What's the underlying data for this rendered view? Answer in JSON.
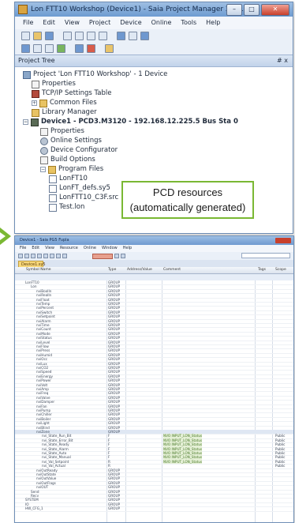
{
  "top_window": {
    "title": "Lon FTT10 Workshop (Device1) - Saia Project Manager 2.1.1...",
    "controls": {
      "minimize": "–",
      "maximize": "□",
      "close": "✕"
    },
    "menu": [
      "File",
      "Edit",
      "View",
      "Project",
      "Device",
      "Online",
      "Tools",
      "Help"
    ],
    "pane_title": "Project Tree",
    "pane_pin": "# x",
    "tree": [
      {
        "label": "Project 'Lon FTT10 Workshop' - 1 Device",
        "icon": "project-icon",
        "level": 0,
        "bold": false
      },
      {
        "label": "Properties",
        "icon": "properties-icon",
        "level": 1,
        "bold": false
      },
      {
        "label": "TCP/IP Settings Table",
        "icon": "tcpip-table-icon",
        "level": 1,
        "bold": false
      },
      {
        "label": "Common Files",
        "icon": "folder-icon",
        "level": 1,
        "bold": false
      },
      {
        "label": "Library Manager",
        "icon": "library-icon",
        "level": 1,
        "bold": false
      },
      {
        "label": "Device1 - PCD3.M3120 - 192.168.12.225.5 Bus Sta 0",
        "icon": "device-icon",
        "level": 0,
        "bold": true
      },
      {
        "label": "Properties",
        "icon": "properties-icon",
        "level": 2,
        "bold": false
      },
      {
        "label": "Online Settings",
        "icon": "online-settings-icon",
        "level": 2,
        "bold": false
      },
      {
        "label": "Device Configurator",
        "icon": "gear-icon",
        "level": 2,
        "bold": false
      },
      {
        "label": "Build Options",
        "icon": "build-options-icon",
        "level": 2,
        "bold": false
      },
      {
        "label": "Program Files",
        "icon": "folder-icon",
        "level": 2,
        "bold": false
      },
      {
        "label": "LonFT10",
        "icon": "file-icon",
        "level": 3,
        "bold": false
      },
      {
        "label": "LonFT_defs.sy5",
        "icon": "file-icon",
        "level": 3,
        "bold": false
      },
      {
        "label": "LonFTT10_C3F.src",
        "icon": "file-icon",
        "level": 3,
        "bold": false
      },
      {
        "label": "Test.lon",
        "icon": "file-icon",
        "level": 3,
        "bold": false
      }
    ],
    "callout": {
      "line1": "PCD resources",
      "line2": "(automatically generated)"
    }
  },
  "bottom_window": {
    "title": "Device1 - Saia PG5 Fupla",
    "menu": [
      "File",
      "Edit",
      "View",
      "Resource",
      "Online",
      "Window",
      "Help"
    ],
    "tab": "Device1.sy5",
    "columns": [
      "Symbol Name",
      "Type",
      "Address/Value",
      "Comment",
      "Tags",
      "Scope"
    ],
    "rows": [
      {
        "name": "LonFT10",
        "type": "GROUP",
        "addr": "",
        "comment": "",
        "scope": "",
        "indent": 1,
        "sel": false
      },
      {
        "name": "Lon",
        "type": "GROUP",
        "addr": "",
        "comment": "",
        "scope": "",
        "indent": 2,
        "sel": false
      },
      {
        "name": "nviBoolIn",
        "type": "GROUP",
        "addr": "",
        "comment": "",
        "scope": "",
        "indent": 3,
        "sel": false
      },
      {
        "name": "nviRealIn",
        "type": "GROUP",
        "addr": "",
        "comment": "",
        "scope": "",
        "indent": 3,
        "sel": false
      },
      {
        "name": "nviFloat",
        "type": "GROUP",
        "addr": "",
        "comment": "",
        "scope": "",
        "indent": 3,
        "sel": false
      },
      {
        "name": "nviTemp",
        "type": "GROUP",
        "addr": "",
        "comment": "",
        "scope": "",
        "indent": 3,
        "sel": false
      },
      {
        "name": "nviPercent",
        "type": "GROUP",
        "addr": "",
        "comment": "",
        "scope": "",
        "indent": 3,
        "sel": false
      },
      {
        "name": "nviSwitch",
        "type": "GROUP",
        "addr": "",
        "comment": "",
        "scope": "",
        "indent": 3,
        "sel": false
      },
      {
        "name": "nviSetpoint",
        "type": "GROUP",
        "addr": "",
        "comment": "",
        "scope": "",
        "indent": 3,
        "sel": false
      },
      {
        "name": "nviAlarm",
        "type": "GROUP",
        "addr": "",
        "comment": "",
        "scope": "",
        "indent": 3,
        "sel": false
      },
      {
        "name": "nviTime",
        "type": "GROUP",
        "addr": "",
        "comment": "",
        "scope": "",
        "indent": 3,
        "sel": false
      },
      {
        "name": "nviCount",
        "type": "GROUP",
        "addr": "",
        "comment": "",
        "scope": "",
        "indent": 3,
        "sel": false
      },
      {
        "name": "nviMode",
        "type": "GROUP",
        "addr": "",
        "comment": "",
        "scope": "",
        "indent": 3,
        "sel": false
      },
      {
        "name": "nviStatus",
        "type": "GROUP",
        "addr": "",
        "comment": "",
        "scope": "",
        "indent": 3,
        "sel": false
      },
      {
        "name": "nviLevel",
        "type": "GROUP",
        "addr": "",
        "comment": "",
        "scope": "",
        "indent": 3,
        "sel": false
      },
      {
        "name": "nviFlow",
        "type": "GROUP",
        "addr": "",
        "comment": "",
        "scope": "",
        "indent": 3,
        "sel": false
      },
      {
        "name": "nviPress",
        "type": "GROUP",
        "addr": "",
        "comment": "",
        "scope": "",
        "indent": 3,
        "sel": false
      },
      {
        "name": "nviHumid",
        "type": "GROUP",
        "addr": "",
        "comment": "",
        "scope": "",
        "indent": 3,
        "sel": false
      },
      {
        "name": "nviOcc",
        "type": "GROUP",
        "addr": "",
        "comment": "",
        "scope": "",
        "indent": 3,
        "sel": false
      },
      {
        "name": "nviLux",
        "type": "GROUP",
        "addr": "",
        "comment": "",
        "scope": "",
        "indent": 3,
        "sel": false
      },
      {
        "name": "nviCO2",
        "type": "GROUP",
        "addr": "",
        "comment": "",
        "scope": "",
        "indent": 3,
        "sel": false
      },
      {
        "name": "nviSpeed",
        "type": "GROUP",
        "addr": "",
        "comment": "",
        "scope": "",
        "indent": 3,
        "sel": false
      },
      {
        "name": "nviEnergy",
        "type": "GROUP",
        "addr": "",
        "comment": "",
        "scope": "",
        "indent": 3,
        "sel": false
      },
      {
        "name": "nviPower",
        "type": "GROUP",
        "addr": "",
        "comment": "",
        "scope": "",
        "indent": 3,
        "sel": false
      },
      {
        "name": "nviVolt",
        "type": "GROUP",
        "addr": "",
        "comment": "",
        "scope": "",
        "indent": 3,
        "sel": false
      },
      {
        "name": "nviAmp",
        "type": "GROUP",
        "addr": "",
        "comment": "",
        "scope": "",
        "indent": 3,
        "sel": false
      },
      {
        "name": "nviFreq",
        "type": "GROUP",
        "addr": "",
        "comment": "",
        "scope": "",
        "indent": 3,
        "sel": false
      },
      {
        "name": "nviValve",
        "type": "GROUP",
        "addr": "",
        "comment": "",
        "scope": "",
        "indent": 3,
        "sel": false
      },
      {
        "name": "nviDamper",
        "type": "GROUP",
        "addr": "",
        "comment": "",
        "scope": "",
        "indent": 3,
        "sel": false
      },
      {
        "name": "nviFan",
        "type": "GROUP",
        "addr": "",
        "comment": "",
        "scope": "",
        "indent": 3,
        "sel": false
      },
      {
        "name": "nviPump",
        "type": "GROUP",
        "addr": "",
        "comment": "",
        "scope": "",
        "indent": 3,
        "sel": false
      },
      {
        "name": "nviChiller",
        "type": "GROUP",
        "addr": "",
        "comment": "",
        "scope": "",
        "indent": 3,
        "sel": false
      },
      {
        "name": "nviBoiler",
        "type": "GROUP",
        "addr": "",
        "comment": "",
        "scope": "",
        "indent": 3,
        "sel": false
      },
      {
        "name": "nviLight",
        "type": "GROUP",
        "addr": "",
        "comment": "",
        "scope": "",
        "indent": 3,
        "sel": false
      },
      {
        "name": "nviBlind",
        "type": "GROUP",
        "addr": "",
        "comment": "",
        "scope": "",
        "indent": 3,
        "sel": false
      },
      {
        "name": "nviZone",
        "type": "GROUP",
        "addr": "",
        "comment": "",
        "scope": "",
        "indent": 3,
        "sel": true
      },
      {
        "name": "nvi_State_Run_Bit",
        "type": "F",
        "addr": "",
        "comment": "NVO INPUT_LON_Status",
        "scope": "Public",
        "indent": 4,
        "sel": false
      },
      {
        "name": "nvi_State_Error_Bit",
        "type": "F",
        "addr": "",
        "comment": "NVO INPUT_LON_Status",
        "scope": "Public",
        "indent": 4,
        "sel": false
      },
      {
        "name": "nvi_State_Ready",
        "type": "F",
        "addr": "",
        "comment": "NVO INPUT_LON_Status",
        "scope": "Public",
        "indent": 4,
        "sel": false
      },
      {
        "name": "nvi_State_Alarm",
        "type": "F",
        "addr": "",
        "comment": "NVO INPUT_LON_Status",
        "scope": "Public",
        "indent": 4,
        "sel": false
      },
      {
        "name": "nvi_State_Auto",
        "type": "F",
        "addr": "",
        "comment": "NVO INPUT_LON_Status",
        "scope": "Public",
        "indent": 4,
        "sel": false
      },
      {
        "name": "nvi_State_Manual",
        "type": "F",
        "addr": "",
        "comment": "NVO INPUT_LON_Status",
        "scope": "Public",
        "indent": 4,
        "sel": false
      },
      {
        "name": "nvi_Val_Setpoint",
        "type": "R",
        "addr": "",
        "comment": "NVO INPUT_LON_Status",
        "scope": "Public",
        "indent": 4,
        "sel": false
      },
      {
        "name": "nvi_Val_Actual",
        "type": "R",
        "addr": "",
        "comment": "",
        "scope": "Public",
        "indent": 4,
        "sel": false
      },
      {
        "name": "nviOutReady",
        "type": "GROUP",
        "addr": "",
        "comment": "",
        "scope": "",
        "indent": 3,
        "sel": false
      },
      {
        "name": "nviOutState",
        "type": "GROUP",
        "addr": "",
        "comment": "",
        "scope": "",
        "indent": 3,
        "sel": false
      },
      {
        "name": "nviOutValue",
        "type": "GROUP",
        "addr": "",
        "comment": "",
        "scope": "",
        "indent": 3,
        "sel": false
      },
      {
        "name": "nviOutFlags",
        "type": "GROUP",
        "addr": "",
        "comment": "",
        "scope": "",
        "indent": 3,
        "sel": false
      },
      {
        "name": "nviOUT",
        "type": "GROUP",
        "addr": "",
        "comment": "",
        "scope": "",
        "indent": 3,
        "sel": false
      },
      {
        "name": "Send",
        "type": "GROUP",
        "addr": "",
        "comment": "",
        "scope": "",
        "indent": 2,
        "sel": false
      },
      {
        "name": "Recv",
        "type": "GROUP",
        "addr": "",
        "comment": "",
        "scope": "",
        "indent": 2,
        "sel": false
      },
      {
        "name": "SYSTEM",
        "type": "GROUP",
        "addr": "",
        "comment": "",
        "scope": "",
        "indent": 1,
        "sel": false
      },
      {
        "name": "IO",
        "type": "GROUP",
        "addr": "",
        "comment": "",
        "scope": "",
        "indent": 1,
        "sel": false
      },
      {
        "name": "HW_CFG_1",
        "type": "GROUP",
        "addr": "",
        "comment": "",
        "scope": "",
        "indent": 1,
        "sel": false
      }
    ]
  },
  "colors": {
    "callout_border": "#7ab833",
    "arrow": "#7ab833",
    "comment_bg": "#e5f0d6",
    "highlight_toolbar": "#e7a08e"
  }
}
